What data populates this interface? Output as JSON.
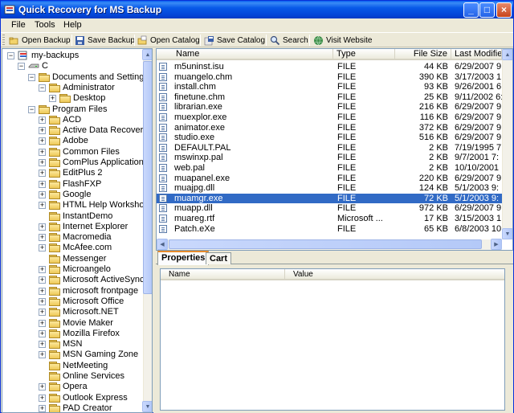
{
  "window": {
    "title": "Quick Recovery for MS Backup",
    "controls": {
      "minimize": "_",
      "maximize": "□",
      "close": "×"
    }
  },
  "menu": [
    "File",
    "Tools",
    "Help"
  ],
  "toolbar": {
    "open_backup": "Open Backup",
    "save_backup": "Save Backup",
    "open_catalog": "Open Catalog",
    "save_catalog": "Save Catalog",
    "search": "Search",
    "visit_website": "Visit Website"
  },
  "tree": {
    "root": "my-backups",
    "drive": "C",
    "items": [
      {
        "label": "Documents and Settings",
        "level": 2
      },
      {
        "label": "Administrator",
        "level": 3
      },
      {
        "label": "Desktop",
        "level": 4
      },
      {
        "label": "Program Files",
        "level": 2
      },
      {
        "label": "ACD",
        "level": 3
      },
      {
        "label": "Active Data Recovery",
        "level": 3
      },
      {
        "label": "Adobe",
        "level": 3
      },
      {
        "label": "Common Files",
        "level": 3
      },
      {
        "label": "ComPlus Applications",
        "level": 3
      },
      {
        "label": "EditPlus 2",
        "level": 3
      },
      {
        "label": "FlashFXP",
        "level": 3
      },
      {
        "label": "Google",
        "level": 3
      },
      {
        "label": "HTML Help Workshop",
        "level": 3
      },
      {
        "label": "InstantDemo",
        "level": 3
      },
      {
        "label": "Internet Explorer",
        "level": 3
      },
      {
        "label": "Macromedia",
        "level": 3
      },
      {
        "label": "McAfee.com",
        "level": 3
      },
      {
        "label": "Messenger",
        "level": 3
      },
      {
        "label": "Microangelo",
        "level": 3
      },
      {
        "label": "Microsoft ActiveSync",
        "level": 3
      },
      {
        "label": "microsoft frontpage",
        "level": 3
      },
      {
        "label": "Microsoft Office",
        "level": 3
      },
      {
        "label": "Microsoft.NET",
        "level": 3
      },
      {
        "label": "Movie Maker",
        "level": 3
      },
      {
        "label": "Mozilla Firefox",
        "level": 3
      },
      {
        "label": "MSN",
        "level": 3
      },
      {
        "label": "MSN Gaming Zone",
        "level": 3
      },
      {
        "label": "NetMeeting",
        "level": 3
      },
      {
        "label": "Online Services",
        "level": 3
      },
      {
        "label": "Opera",
        "level": 3
      },
      {
        "label": "Outlook Express",
        "level": 3
      },
      {
        "label": "PAD Creator",
        "level": 3
      }
    ]
  },
  "file_list": {
    "columns": [
      "Name",
      "Type",
      "File Size",
      "Last Modified"
    ],
    "selected_index": 13,
    "rows": [
      {
        "name": "m5uninst.isu",
        "type": "FILE",
        "size": "44 KB",
        "modified": "6/29/2007 9:"
      },
      {
        "name": "muangelo.chm",
        "type": "FILE",
        "size": "390 KB",
        "modified": "3/17/2003 1:"
      },
      {
        "name": "install.chm",
        "type": "FILE",
        "size": "93 KB",
        "modified": "9/26/2001 6:"
      },
      {
        "name": "finetune.chm",
        "type": "FILE",
        "size": "25 KB",
        "modified": "9/11/2002 6:"
      },
      {
        "name": "librarian.exe",
        "type": "FILE",
        "size": "216 KB",
        "modified": "6/29/2007 9:"
      },
      {
        "name": "muexplor.exe",
        "type": "FILE",
        "size": "116 KB",
        "modified": "6/29/2007 9:"
      },
      {
        "name": "animator.exe",
        "type": "FILE",
        "size": "372 KB",
        "modified": "6/29/2007 9:"
      },
      {
        "name": "studio.exe",
        "type": "FILE",
        "size": "516 KB",
        "modified": "6/29/2007 9:"
      },
      {
        "name": "DEFAULT.PAL",
        "type": "FILE",
        "size": "2 KB",
        "modified": "7/19/1995 7:"
      },
      {
        "name": "mswinxp.pal",
        "type": "FILE",
        "size": "2 KB",
        "modified": "9/7/2001 7:"
      },
      {
        "name": "web.pal",
        "type": "FILE",
        "size": "2 KB",
        "modified": "10/10/2001"
      },
      {
        "name": "muapanel.exe",
        "type": "FILE",
        "size": "220 KB",
        "modified": "6/29/2007 9:"
      },
      {
        "name": "muajpg.dll",
        "type": "FILE",
        "size": "124 KB",
        "modified": "5/1/2003 9:"
      },
      {
        "name": "muamgr.exe",
        "type": "FILE",
        "size": "72 KB",
        "modified": "5/1/2003 9:"
      },
      {
        "name": "muapp.dll",
        "type": "FILE",
        "size": "972 KB",
        "modified": "6/29/2007 9:"
      },
      {
        "name": "muareg.rtf",
        "type": "Microsoft ...",
        "size": "17 KB",
        "modified": "3/15/2003 1:"
      },
      {
        "name": "Patch.eXe",
        "type": "FILE",
        "size": "65 KB",
        "modified": "6/8/2003 10:"
      }
    ]
  },
  "properties": {
    "tabs": [
      "Properties",
      "Cart"
    ],
    "columns": [
      "Name",
      "Value"
    ]
  },
  "colors": {
    "selection": "#316ac5",
    "titlebar": "#0859e8",
    "folder": "#eec958"
  }
}
